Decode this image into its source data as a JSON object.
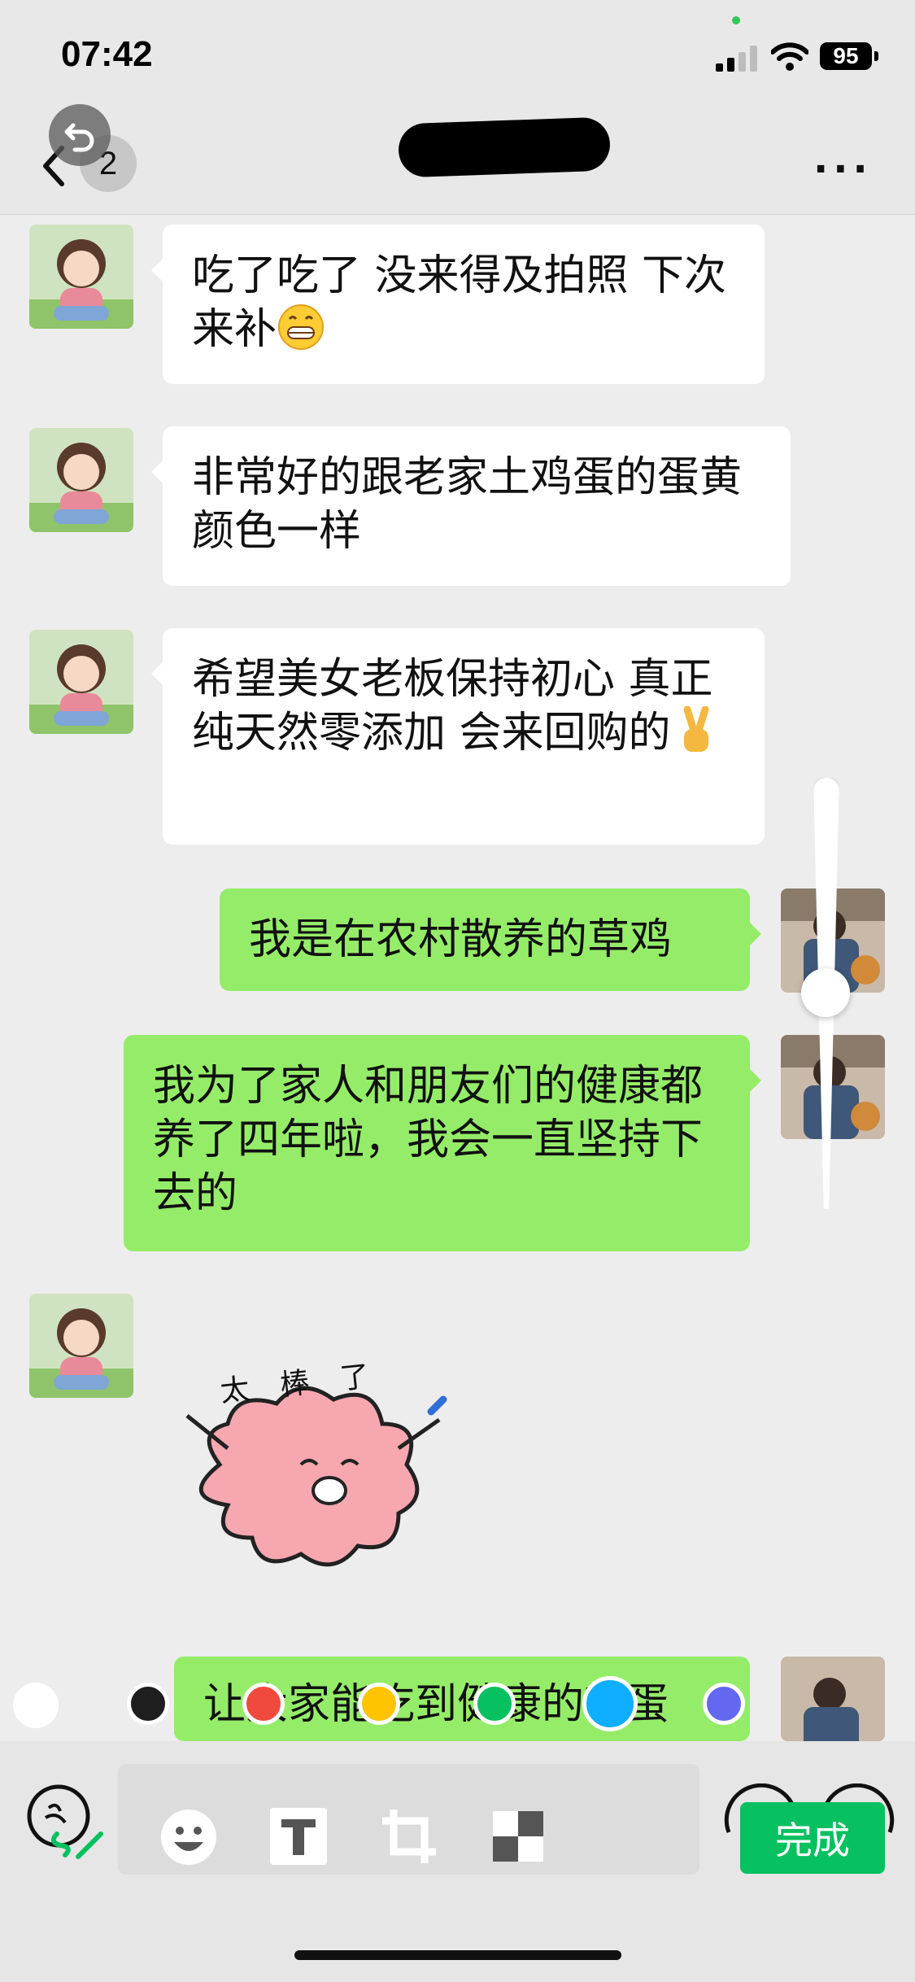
{
  "status_bar": {
    "time": "07:42",
    "battery": "95"
  },
  "nav": {
    "back_count": "2",
    "undo_icon": "undo-icon",
    "more_icon": "more-icon"
  },
  "messages": [
    {
      "side": "left",
      "text": "吃了吃了 没来得及拍照 下次来补"
    },
    {
      "side": "left",
      "text": "非常好的跟老家土鸡蛋的蛋黄颜色一样"
    },
    {
      "side": "left",
      "text": "希望美女老板保持初心  真正纯天然零添加  会来回购的"
    },
    {
      "side": "right",
      "text": "我是在农村散养的草鸡"
    },
    {
      "side": "right",
      "text": "我为了家人和朋友们的健康都养了四年啦，我会一直坚持下去的"
    },
    {
      "side": "left",
      "sticker": "太棒了"
    },
    {
      "side": "right",
      "text": "让大家能吃到健康的鸡蛋"
    }
  ],
  "palette": {
    "colors": [
      "#ffffff",
      "#1e1e1e",
      "#f04a3e",
      "#ffc300",
      "#07c160",
      "#10aeff",
      "#6467f0"
    ],
    "selected": "#10aeff"
  },
  "toolbar": {
    "done_label": "完成"
  }
}
